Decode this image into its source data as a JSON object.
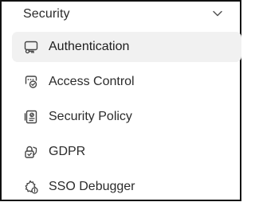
{
  "section": {
    "title": "Security",
    "toggle_icon": "chevron-down-icon"
  },
  "menu": {
    "items": [
      {
        "label": "Authentication",
        "icon": "auth-key-card-icon",
        "active": true
      },
      {
        "label": "Access Control",
        "icon": "access-control-icon",
        "active": false
      },
      {
        "label": "Security Policy",
        "icon": "policy-document-icon",
        "active": false
      },
      {
        "label": "GDPR",
        "icon": "gdpr-shield-check-icon",
        "active": false
      },
      {
        "label": "SSO Debugger",
        "icon": "sso-debugger-gear-icon",
        "active": false
      }
    ]
  },
  "colors": {
    "text": "#2b2b2b",
    "active_background": "#f1f1f1",
    "icon_stroke": "#444444"
  }
}
